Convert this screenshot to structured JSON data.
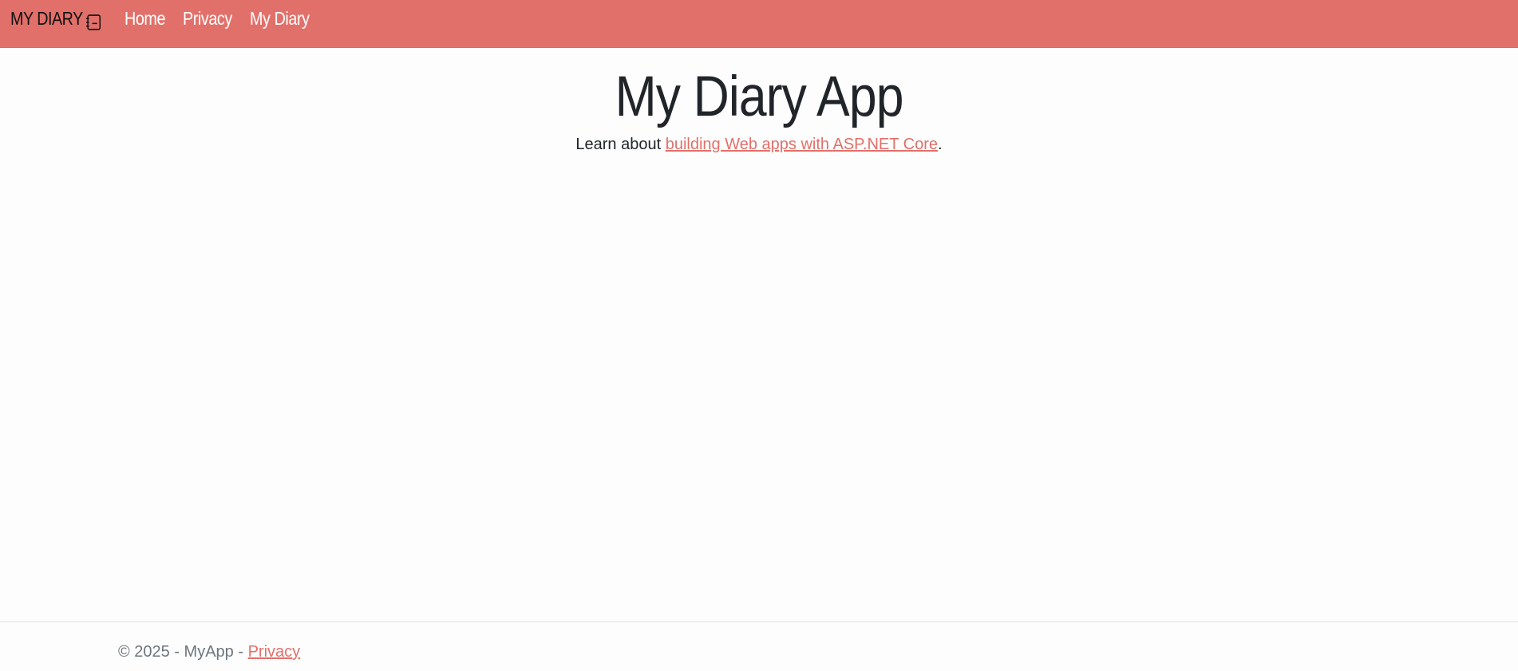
{
  "navbar": {
    "brand": "MY DIARY",
    "brand_icon": "journal-icon",
    "links": [
      "Home",
      "Privacy",
      "My Diary"
    ],
    "background_color": "#e2706a"
  },
  "main": {
    "title": "My Diary App",
    "lead_prefix": "Learn about ",
    "lead_link": "building Web apps with ASP.NET Core",
    "lead_suffix": "."
  },
  "footer": {
    "copyright": "© 2025 - MyApp - ",
    "privacy_link": "Privacy"
  },
  "colors": {
    "accent": "#e2706a",
    "text": "#212529",
    "muted": "#6c757d"
  }
}
